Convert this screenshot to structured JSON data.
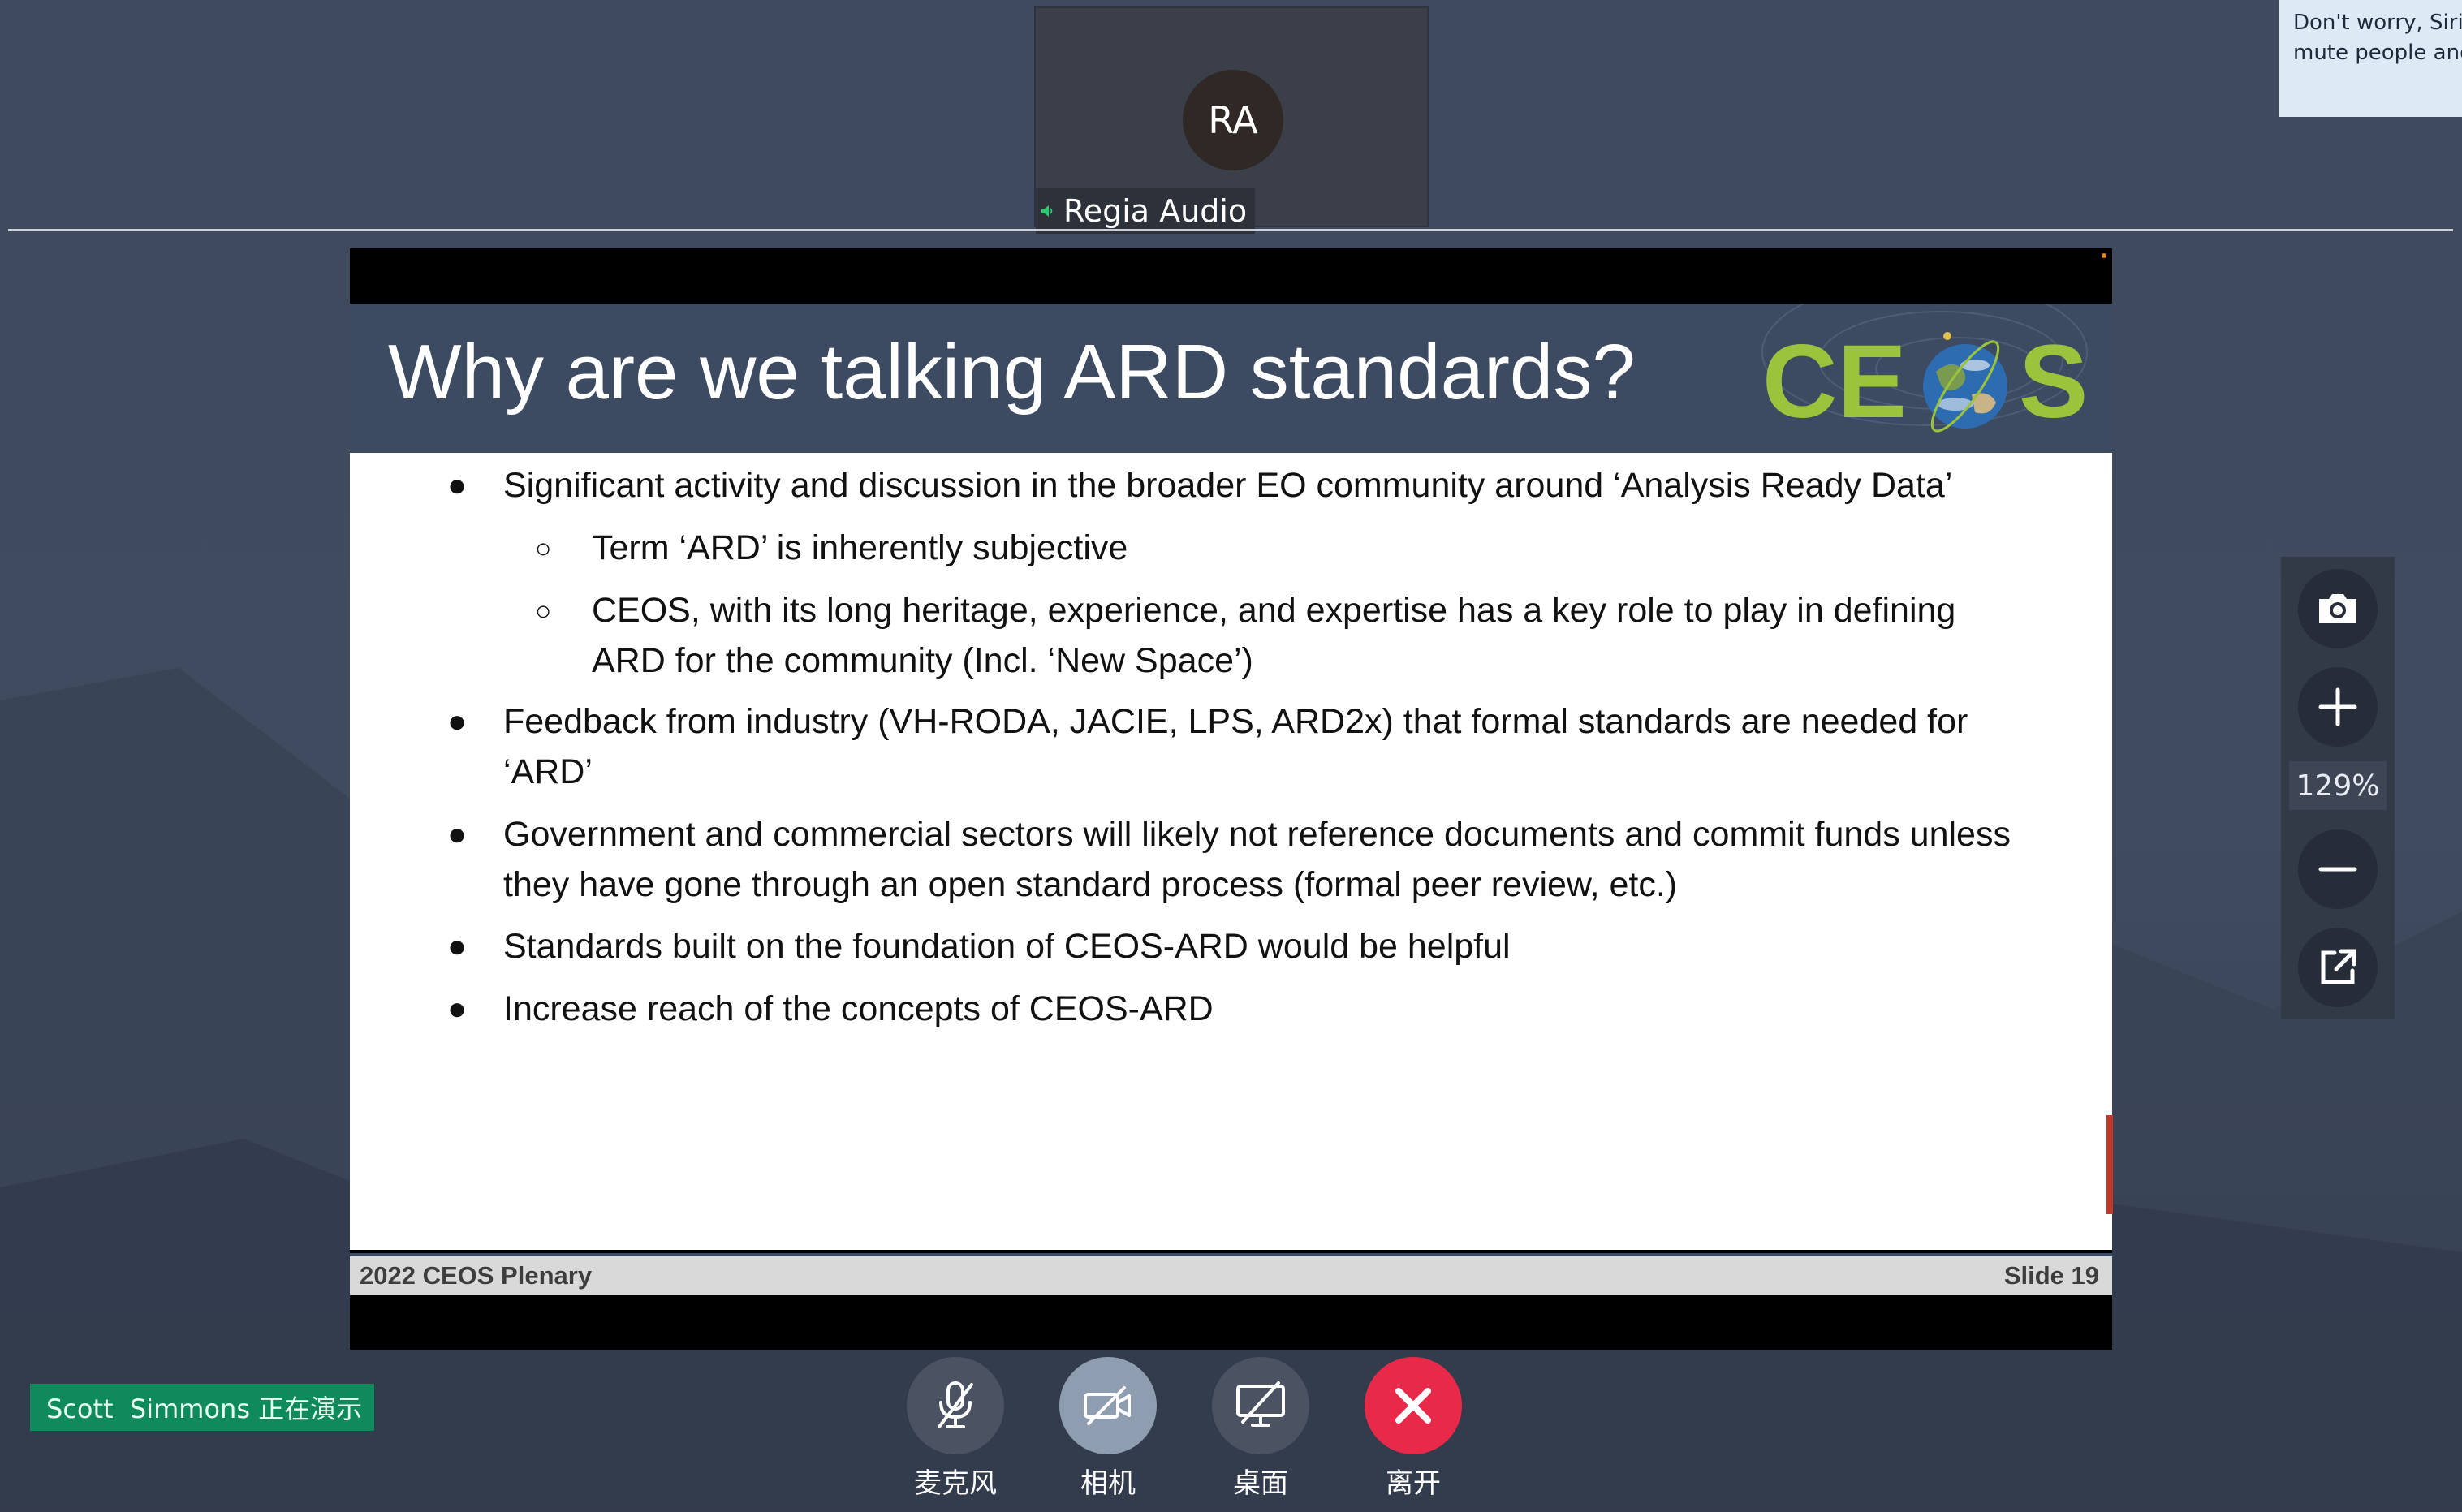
{
  "participant": {
    "initials": "RA",
    "name": "Regia Audio"
  },
  "chat_toast": {
    "line1": "Don't worry, Siri J",
    "line2": "mute people and"
  },
  "slide": {
    "title": "Why are we talking ARD standards?",
    "logo_text": "CEOS",
    "bullets": [
      "Significant activity and discussion in the broader EO community around ‘Analysis Ready Data’",
      "Term ‘ARD’ is inherently subjective",
      "CEOS, with its long heritage, experience, and expertise has a key role to play in defining",
      "ARD for the community (Incl. ‘New Space’)",
      "Feedback from industry (VH-RODA, JACIE, LPS, ARD2x) that formal standards are needed for",
      "‘ARD’",
      "Government and commercial sectors will likely not reference documents and commit funds unless",
      "they have gone through an open standard process (formal peer review, etc.)",
      "Standards built on the foundation of CEOS-ARD would be helpful",
      "Increase reach of the concepts of CEOS-ARD"
    ],
    "footer_left": "2022 CEOS Plenary",
    "footer_right": "Slide 19"
  },
  "zoom": {
    "level": "129%",
    "icons": [
      "camera-icon",
      "zoom-in-icon",
      "zoom-out-icon",
      "pop-out-icon"
    ]
  },
  "presenter_banner": "Scott  Simmons 正在演示",
  "controls": {
    "mic": "麦克风",
    "camera": "相机",
    "desktop": "桌面",
    "leave": "离开"
  },
  "colors": {
    "leave": "#e8294a",
    "camera_active": "#8f9db0",
    "presenter_banner": "#0f8a5a",
    "slide_header": "#3c4b62",
    "logo_green": "#9bc33b"
  }
}
